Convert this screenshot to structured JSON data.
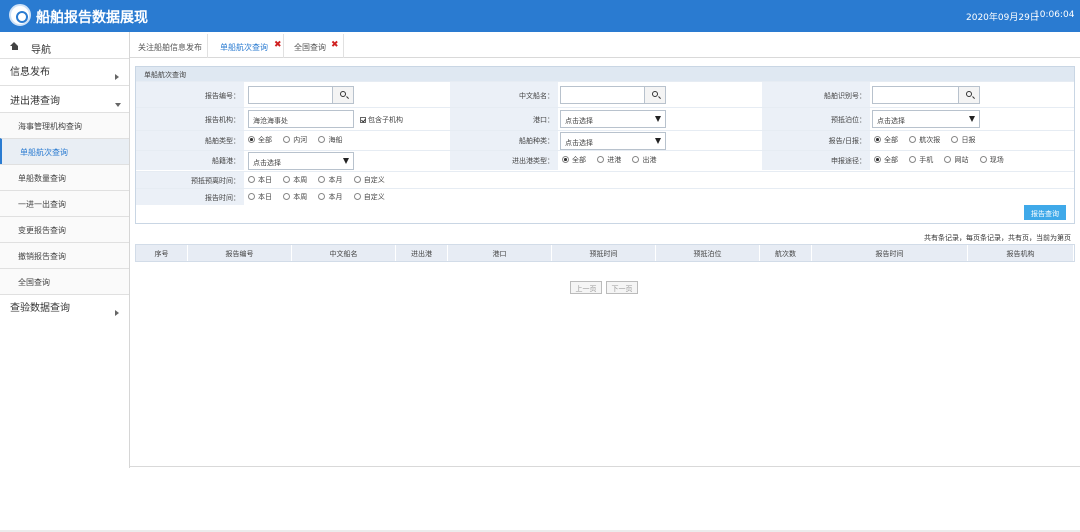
{
  "header": {
    "title": "船舶报告数据展现",
    "date": "2020年09月29日",
    "time": "10:06:04"
  },
  "sidebar": {
    "nav_label": "导航",
    "groups": [
      {
        "label": "信息发布"
      },
      {
        "label": "进出港查询"
      },
      {
        "label": "查验数据查询"
      }
    ],
    "sub_items": [
      {
        "label": "海事管理机构查询"
      },
      {
        "label": "单船航次查询"
      },
      {
        "label": "单船数量查询"
      },
      {
        "label": "一进一出查询"
      },
      {
        "label": "变更报告查询"
      },
      {
        "label": "撤销报告查询"
      },
      {
        "label": "全国查询"
      }
    ]
  },
  "tabs": [
    {
      "label": "关注船舶信息发布"
    },
    {
      "label": "单船航次查询"
    },
    {
      "label": "全国查询"
    }
  ],
  "form": {
    "panel_title": "单船航次查询",
    "labels": {
      "report_no": "报告编号：",
      "cn_name": "中文船名：",
      "ship_id": "船舶识别号：",
      "report_org": "报告机构：",
      "port": "港口：",
      "berth": "预抵泊位：",
      "ship_type": "船舶类型：",
      "ship_kind": "船舶种类：",
      "report_daily": "报告/日报：",
      "nationality": "船籍港：",
      "inout_type": "进出港类型：",
      "apply_channel": "申报途径：",
      "est_time": "预抵预离时间：",
      "report_time": "报告时间："
    },
    "values": {
      "report_org": "海沧海事处",
      "include_sub": "包含子机构",
      "select_placeholder": "点击选择"
    },
    "radios": {
      "ship_type": [
        "全部",
        "内河",
        "海船"
      ],
      "report_daily": [
        "全部",
        "航次报",
        "日报"
      ],
      "inout_type": [
        "全部",
        "进港",
        "出港"
      ],
      "apply_channel": [
        "全部",
        "手机",
        "网站",
        "现场"
      ],
      "time_range": [
        "本日",
        "本周",
        "本月",
        "自定义"
      ]
    },
    "submit_label": "报告查询"
  },
  "summary": "共有条记录，每页条记录，共有页，当前为第页",
  "table": {
    "columns": [
      "序号",
      "报告编号",
      "中文船名",
      "进出港",
      "港口",
      "预抵时间",
      "预抵泊位",
      "航次数",
      "报告时间",
      "报告机构"
    ]
  },
  "pager": {
    "prev": "上一页",
    "next": "下一页"
  }
}
